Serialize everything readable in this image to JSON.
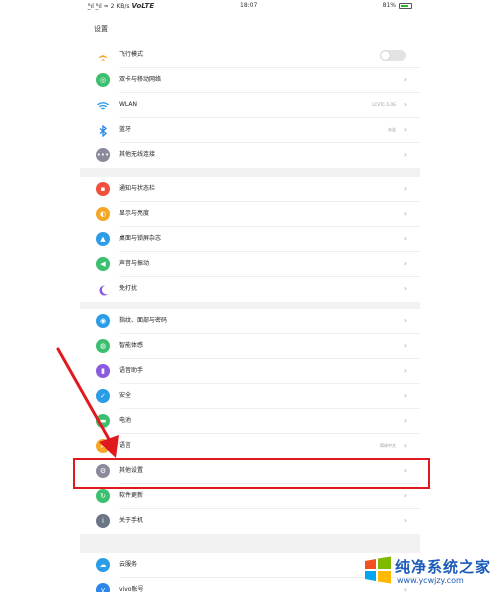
{
  "status_bar": {
    "left": "ᴮ̲ıl ᴮ̲ıl ≈ 2 KB/s",
    "volte": "VoLTE",
    "time": "18:07",
    "right": "81%",
    "battery_level": 0.81
  },
  "header": {
    "title": "设置"
  },
  "groups": [
    {
      "items": [
        {
          "label": "飞行模式",
          "icon": "airplane-icon",
          "color": "#f5a623",
          "toggle": true,
          "toggle_on": false
        },
        {
          "label": "双卡与移动网络",
          "icon": "globe-icon",
          "color": "#3cbf6e"
        },
        {
          "label": "WLAN",
          "icon": "wifi-icon",
          "color": "#2b9de8",
          "value": "LCVTC-5.0G"
        },
        {
          "label": "蓝牙",
          "icon": "bluetooth-icon",
          "color": "#2b87e8",
          "value": "未连"
        },
        {
          "label": "其他无线连接",
          "icon": "more-icon",
          "color": "#8a8a9a"
        }
      ]
    },
    {
      "items": [
        {
          "label": "通知与状态栏",
          "icon": "notification-icon",
          "color": "#f0503c"
        },
        {
          "label": "显示与亮度",
          "icon": "brightness-icon",
          "color": "#f5a623"
        },
        {
          "label": "桌面与锁屏杂志",
          "icon": "wallpaper-icon",
          "color": "#2b9de8"
        },
        {
          "label": "声音与振动",
          "icon": "sound-icon",
          "color": "#3cbf6e"
        },
        {
          "label": "免打扰",
          "icon": "moon-icon",
          "color": "#8a5ae0"
        }
      ]
    },
    {
      "items": [
        {
          "label": "指纹、面部与密码",
          "icon": "fingerprint-icon",
          "color": "#2b9de8"
        },
        {
          "label": "智能体感",
          "icon": "smart-icon",
          "color": "#3cbf6e"
        },
        {
          "label": "语音助手",
          "icon": "microphone-icon",
          "color": "#8a5ae0"
        },
        {
          "label": "安全",
          "icon": "shield-icon",
          "color": "#2b9de8"
        },
        {
          "label": "电池",
          "icon": "battery-icon",
          "color": "#3cbf6e"
        },
        {
          "label": "语言",
          "icon": "language-icon",
          "color": "#f5a623",
          "value": "简体中文"
        },
        {
          "label": "其他设置",
          "icon": "gear-icon",
          "color": "#8a8a9a"
        },
        {
          "label": "软件更新",
          "icon": "update-icon",
          "color": "#3cbf6e"
        },
        {
          "label": "关于手机",
          "icon": "info-icon",
          "color": "#6a7585"
        }
      ]
    },
    {
      "items": [
        {
          "label": "云服务",
          "icon": "cloud-icon",
          "color": "#2b9de8"
        },
        {
          "label": "vivo账号",
          "icon": "account-icon",
          "color": "#2b87e8"
        }
      ]
    }
  ],
  "watermark": {
    "title": "纯净系统之家",
    "url": "www.ycwjzy.com"
  },
  "colors": {
    "highlight": "#e0191f",
    "group_gap": "#f2f2f2"
  }
}
